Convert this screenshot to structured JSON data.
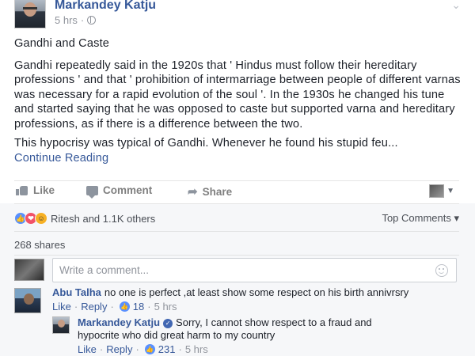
{
  "post": {
    "author": "Markandey Katju",
    "time": "5 hrs",
    "title": "Gandhi and Caste",
    "paragraph1": "Gandhi repeatedly said in the 1920s that ' Hindus must follow their hereditary professions ' and that ' prohibition of intermarriage between people of different varnas was necessary for a rapid evolution of the soul '. In the 1930s he changed his tune and started saying that he was opposed to caste but supported varna and hereditary professions, as if there is a difference between the two.",
    "paragraph2": "This hypocrisy was typical of Gandhi. Whenever he found his stupid feu...",
    "continue_label": "Continue Reading"
  },
  "actions": {
    "like": "Like",
    "comment": "Comment",
    "share": "Share"
  },
  "feedback": {
    "reactors": "Ritesh and 1.1K others",
    "top_comments": "Top Comments ▾",
    "shares": "268 shares",
    "composer_placeholder": "Write a comment..."
  },
  "comments": [
    {
      "author": "Abu Talha",
      "text": "no one is perfect ,at least show some respect on his birth annivrsry",
      "like_label": "Like",
      "reply_label": "Reply",
      "likes": "18",
      "time": "5 hrs"
    },
    {
      "author": "Markandey Katju",
      "text": "Sorry, I cannot show respect to a fraud and hypocrite who did great harm to my country",
      "like_label": "Like",
      "reply_label": "Reply",
      "likes": "231",
      "time": "5 hrs"
    }
  ],
  "separators": {
    "dot": "·"
  }
}
